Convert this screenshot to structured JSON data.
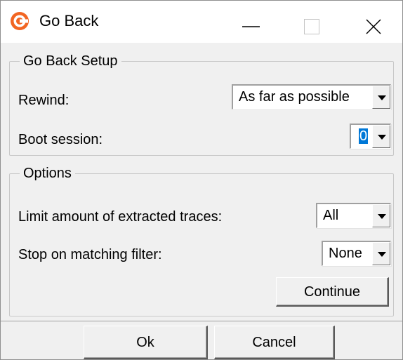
{
  "window": {
    "title": "Go Back",
    "icon": "app-logo-icon",
    "controls": [
      "minimize-icon",
      "maximize-icon",
      "close-icon"
    ]
  },
  "setup_group": {
    "title": "Go Back Setup",
    "rewind_label": "Rewind:",
    "rewind_value": "As far as possible",
    "boot_session_label": "Boot session:",
    "boot_session_value": "0"
  },
  "options_group": {
    "title": "Options",
    "limit_label": "Limit amount of extracted traces:",
    "limit_value": "All",
    "stop_label": "Stop on matching filter:",
    "stop_value": "None",
    "continue_label": "Continue"
  },
  "footer": {
    "ok_label": "Ok",
    "cancel_label": "Cancel"
  },
  "colors": {
    "accent": "#0078d7",
    "app_icon": "#f26522",
    "face": "#f0f0f0"
  }
}
